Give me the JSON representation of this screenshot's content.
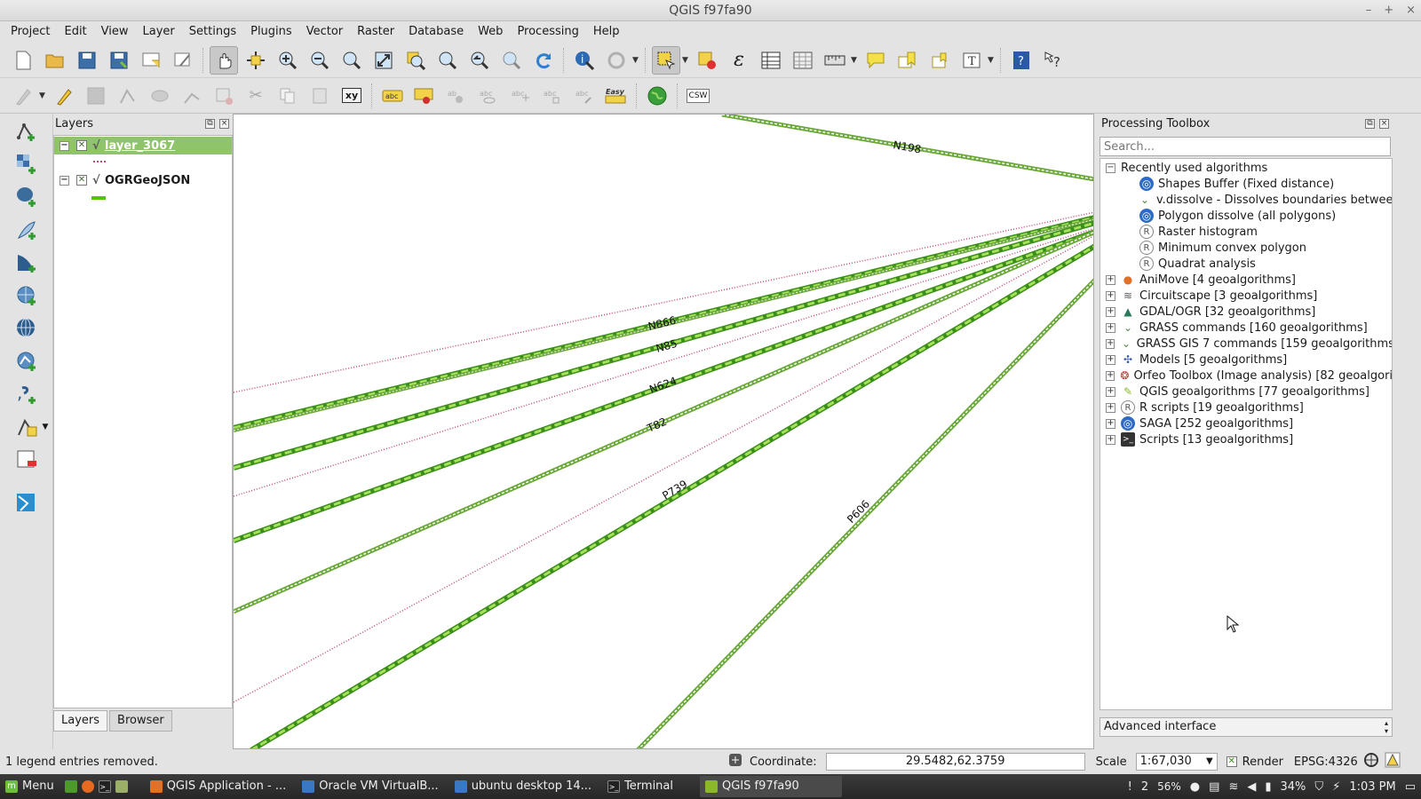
{
  "window": {
    "title": "QGIS f97fa90",
    "controls": [
      "–",
      "+",
      "×"
    ]
  },
  "menubar": [
    "Project",
    "Edit",
    "View",
    "Layer",
    "Settings",
    "Plugins",
    "Vector",
    "Raster",
    "Database",
    "Web",
    "Processing",
    "Help"
  ],
  "toolbar2": {
    "xy_label": "xy",
    "easy_label": "Easy",
    "csw_label": "CSW"
  },
  "layers_panel": {
    "title": "Layers",
    "items": [
      {
        "name": "layer_3067",
        "selected": true
      },
      {
        "name": "OGRGeoJSON",
        "selected": false
      }
    ],
    "tabs": [
      "Layers",
      "Browser"
    ]
  },
  "map": {
    "labels": [
      "N198",
      "N866",
      "N85",
      "N624",
      "T82",
      "P739",
      "P606"
    ],
    "colors": {
      "green": "#58c400",
      "pink": "#c0487a"
    }
  },
  "toolbox": {
    "title": "Processing Toolbox",
    "search_placeholder": "Search...",
    "recent_group": "Recently used algorithms",
    "recent": [
      {
        "label": "Shapes Buffer (Fixed distance)",
        "icon": "saga-icon"
      },
      {
        "label": "v.dissolve - Dissolves boundaries between ...",
        "icon": "grass-icon"
      },
      {
        "label": "Polygon dissolve (all polygons)",
        "icon": "saga-icon"
      },
      {
        "label": "Raster histogram",
        "icon": "r-icon"
      },
      {
        "label": "Minimum convex polygon",
        "icon": "r-icon"
      },
      {
        "label": "Quadrat analysis",
        "icon": "r-icon"
      }
    ],
    "providers": [
      {
        "label": "AniMove [4 geoalgorithms]",
        "icon": "animove-icon"
      },
      {
        "label": "Circuitscape [3 geoalgorithms]",
        "icon": "circuitscape-icon"
      },
      {
        "label": "GDAL/OGR [32 geoalgorithms]",
        "icon": "gdal-icon"
      },
      {
        "label": "GRASS commands [160 geoalgorithms]",
        "icon": "grass-icon"
      },
      {
        "label": "GRASS GIS 7 commands [159 geoalgorithms]",
        "icon": "grass-icon"
      },
      {
        "label": "Models [5 geoalgorithms]",
        "icon": "models-icon"
      },
      {
        "label": "Orfeo Toolbox (Image analysis) [82 geoalgorit...",
        "icon": "otb-icon"
      },
      {
        "label": "QGIS geoalgorithms [77 geoalgorithms]",
        "icon": "qgis-icon"
      },
      {
        "label": "R scripts [19 geoalgorithms]",
        "icon": "r-icon"
      },
      {
        "label": "SAGA [252 geoalgorithms]",
        "icon": "saga-icon"
      },
      {
        "label": "Scripts [13 geoalgorithms]",
        "icon": "scripts-icon"
      }
    ],
    "interface": "Advanced interface"
  },
  "statusbar": {
    "message": "1 legend entries removed.",
    "coordinate_label": "Coordinate:",
    "coordinate_value": "29.5482,62.3759",
    "scale_label": "Scale",
    "scale_value": "1:67,030",
    "render_label": "Render",
    "crs": "EPSG:4326"
  },
  "taskbar": {
    "menu": "Menu",
    "tasks": [
      {
        "label": "QGIS Application - ...",
        "active": false
      },
      {
        "label": "Oracle VM VirtualB...",
        "active": false
      },
      {
        "label": "ubuntu desktop 14...",
        "active": false
      },
      {
        "label": "Terminal",
        "active": false
      },
      {
        "label": "QGIS f97fa90",
        "active": true
      }
    ],
    "notify_count": "2",
    "cpu": "56%",
    "battery": "34%",
    "clock": "1:03 PM"
  }
}
